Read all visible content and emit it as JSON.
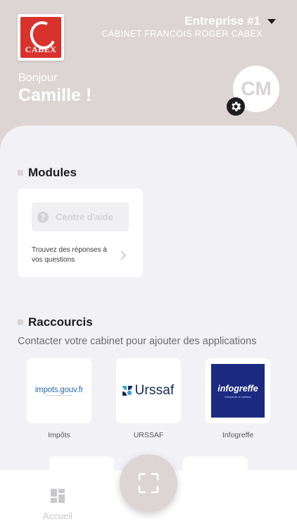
{
  "header": {
    "logo_text": "CABEX",
    "company_name": "Entreprise #1",
    "cabinet_name": "CABINET FRANCOIS ROGER CABEX",
    "greeting": "Bonjour",
    "user_name": "Camille !",
    "avatar_initials": "CM"
  },
  "modules": {
    "title": "Modules",
    "help_button": "Centre d'aide",
    "help_description": "Trouvez des réponses à vos questions"
  },
  "shortcuts": {
    "title": "Raccourcis",
    "subtitle": "Contacter votre cabinet pour ajouter des applications",
    "apps": [
      {
        "label": "Impôts",
        "logo": "impots.gouv.fr",
        "logo_caption": "Nos services en ligne pour vos impôts"
      },
      {
        "label": "URSSAF",
        "logo": "Urssaf"
      },
      {
        "label": "Infogreffe",
        "logo": "infogreffe",
        "logo_caption": "Entreprendre en confiance"
      }
    ]
  },
  "tabbar": {
    "home_label": "Accueil"
  },
  "colors": {
    "header_bg": "#ddd5d4",
    "panel_bg": "#f2f2f6",
    "cabex_red": "#d9322d",
    "infogreffe_blue": "#1b2a80",
    "urssaf_blue": "#0e2a5a"
  },
  "icons": {
    "caret": "caret-down-icon",
    "gear": "gear-icon",
    "help": "question-circle-icon",
    "chevron": "chevron-right-icon",
    "home": "dashboard-grid-icon",
    "scan": "scan-frame-icon"
  }
}
